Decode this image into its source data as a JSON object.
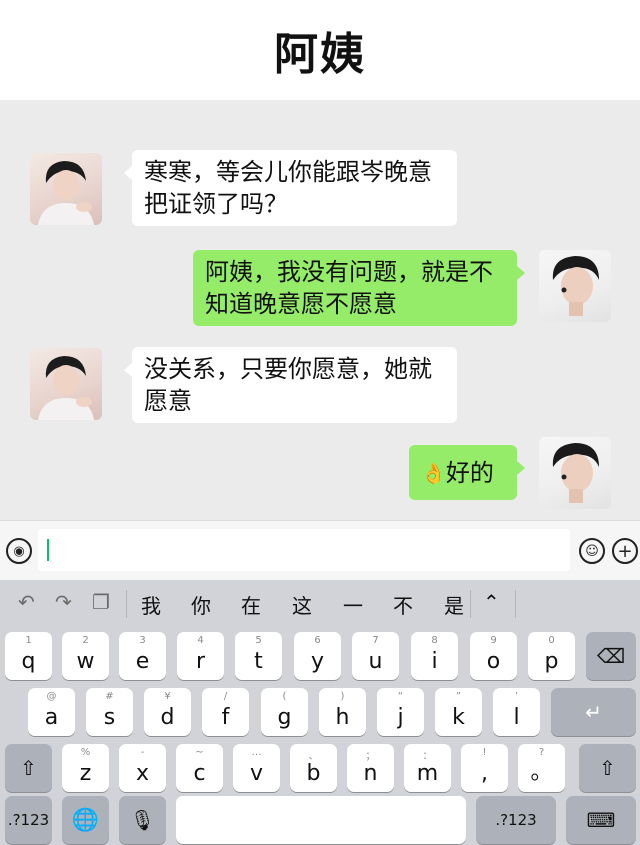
{
  "header": {
    "title": "阿姨"
  },
  "messages": [
    {
      "side": "left",
      "sender": "auntie",
      "text_line1": "寒寒，等会儿你能跟岑晚意",
      "text_line2": "把证领了吗？"
    },
    {
      "side": "right",
      "sender": "boy",
      "text_line1": "阿姨，我没有问题，就是不",
      "text_line2": "知道晚意愿不愿意"
    },
    {
      "side": "left",
      "sender": "auntie",
      "text_line1": "没关系，只要你愿意，她就",
      "text_line2": "愿意"
    },
    {
      "side": "right",
      "sender": "boy",
      "emoji": "👌",
      "text_line1": "好的"
    }
  ],
  "input_bar": {
    "voice_icon": "voice-icon",
    "emoji_icon": "smiley-icon",
    "plus_icon": "plus-icon",
    "value": ""
  },
  "suggestions": {
    "tools": [
      "undo-icon",
      "redo-icon",
      "clipboard-icon"
    ],
    "words": [
      "我",
      "你",
      "在",
      "这",
      "一",
      "不",
      "是"
    ],
    "collapse_icon": "chevron-up-icon"
  },
  "keyboard": {
    "row1": [
      {
        "hint": "1",
        "key": "q"
      },
      {
        "hint": "2",
        "key": "w"
      },
      {
        "hint": "3",
        "key": "e"
      },
      {
        "hint": "4",
        "key": "r"
      },
      {
        "hint": "5",
        "key": "t"
      },
      {
        "hint": "6",
        "key": "y"
      },
      {
        "hint": "7",
        "key": "u"
      },
      {
        "hint": "8",
        "key": "i"
      },
      {
        "hint": "9",
        "key": "o"
      },
      {
        "hint": "0",
        "key": "p"
      }
    ],
    "row2": [
      {
        "hint": "@",
        "key": "a"
      },
      {
        "hint": "#",
        "key": "s"
      },
      {
        "hint": "¥",
        "key": "d"
      },
      {
        "hint": "/",
        "key": "f"
      },
      {
        "hint": "(",
        "key": "g"
      },
      {
        "hint": ")",
        "key": "h"
      },
      {
        "hint": "“",
        "key": "j"
      },
      {
        "hint": "”",
        "key": "k"
      },
      {
        "hint": "’",
        "key": "l"
      }
    ],
    "row3": [
      {
        "hint": "%",
        "key": "z"
      },
      {
        "hint": "-",
        "key": "x"
      },
      {
        "hint": "~",
        "key": "c"
      },
      {
        "hint": "…",
        "key": "v"
      },
      {
        "hint": "、",
        "key": "b"
      },
      {
        "hint": "；",
        "key": "n"
      },
      {
        "hint": "：",
        "key": "m"
      },
      {
        "hint": "!",
        "key": ","
      },
      {
        "hint": "?",
        "key": "。"
      }
    ],
    "bottom": {
      "left_label": ".?123",
      "right_label": ".?123"
    },
    "colors": {
      "keyboard_bg": "#d1d3d9",
      "key_bg": "#ffffff",
      "func_key_bg": "#adb1ba"
    }
  },
  "colors": {
    "chat_bg": "#ebebeb",
    "self_bubble": "#95ec69",
    "other_bubble": "#ffffff",
    "cursor": "#07c160"
  }
}
